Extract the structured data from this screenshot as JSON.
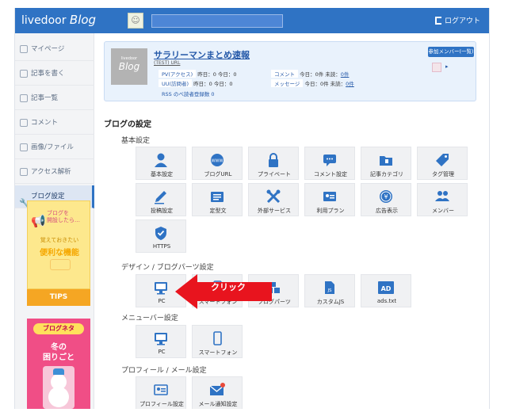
{
  "header": {
    "brand_plain": "livedoor ",
    "brand_italic": "Blog",
    "logout_label": "ログアウト",
    "accent": "#2f73c4"
  },
  "sidebar": {
    "items": [
      {
        "label": "マイページ",
        "icon": "home-icon"
      },
      {
        "label": "記事を書く",
        "icon": "pen-icon"
      },
      {
        "label": "記事一覧",
        "icon": "list-icon"
      },
      {
        "label": "コメント",
        "icon": "comment-icon"
      },
      {
        "label": "画像/ファイル",
        "icon": "image-icon"
      },
      {
        "label": "アクセス解析",
        "icon": "bar-chart-icon"
      },
      {
        "label": "ブログ設定",
        "icon": "wrench-icon",
        "active": true
      }
    ],
    "banner_tips": {
      "headline": "ブログを\n開設したら…",
      "sub": "覚えておきたい",
      "big": "便利な機能",
      "button": "TIPS"
    },
    "banner_neta": {
      "pill": "ブログネタ",
      "line1": "冬の",
      "line2": "困りごと"
    }
  },
  "blog_card": {
    "thumb_small": "livedoor",
    "thumb_big": "Blog",
    "title": "サラリーマンまとめ速報",
    "url_text": "(TEST) URL",
    "stats": {
      "pv_label": "PV(アクセス)",
      "pv_values": "昨日：0 今日：0",
      "uu_label": "UU(訪問者)",
      "uu_values": "昨日：0 今日：0",
      "comment_label": "コメント",
      "comment_values": "今日：0件 未読：",
      "comment_link": "0件",
      "message_label": "メッセージ",
      "message_values": "今日：0件 未読：",
      "message_link": "0件"
    },
    "reader": "RSS のべ読者登録数 0",
    "member_button": "参加メンバー(一覧)"
  },
  "settings": {
    "section_title": "ブログの設定",
    "basic": {
      "title": "基本設定",
      "tiles": [
        "基本設定",
        "ブログURL",
        "プライベート",
        "コメント設定",
        "記事カテゴリ",
        "タグ管理",
        "投稿設定",
        "定型文",
        "外部サービス",
        "利用プラン",
        "広告表示",
        "メンバー",
        "HTTPS"
      ]
    },
    "design": {
      "title": "デザイン / ブログパーツ設定",
      "tiles": [
        "PC",
        "スマートフォン",
        "ブログパーツ",
        "カスタムJS",
        "ads.txt"
      ]
    },
    "menubar": {
      "title": "メニューバー設定",
      "tiles": [
        "PC",
        "スマートフォン"
      ]
    },
    "profile": {
      "title": "プロフィール / メール設定",
      "tiles": [
        "プロフィール設定",
        "メール通知設定"
      ]
    }
  },
  "annotation": {
    "arrow_text": "クリック",
    "arrow_color": "#e8141e"
  }
}
